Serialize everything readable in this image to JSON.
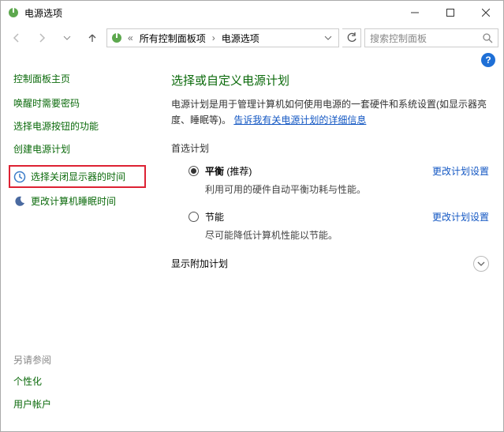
{
  "window": {
    "title": "电源选项"
  },
  "breadcrumb": {
    "item1": "所有控制面板项",
    "item2": "电源选项"
  },
  "search": {
    "placeholder": "搜索控制面板"
  },
  "sidebar": {
    "home": "控制面板主页",
    "links": {
      "l0": "唤醒时需要密码",
      "l1": "选择电源按钮的功能",
      "l2": "创建电源计划",
      "l3": "选择关闭显示器的时间",
      "l4": "更改计算机睡眠时间"
    },
    "seealso": "另请参阅",
    "seealso_items": {
      "s0": "个性化",
      "s1": "用户帐户"
    }
  },
  "main": {
    "heading": "选择或自定义电源计划",
    "desc_prefix": "电源计划是用于管理计算机如何使用电源的一套硬件和系统设置(如显示器亮度、睡眠等)。",
    "desc_link": "告诉我有关电源计划的详细信息",
    "preferred": "首选计划",
    "plan1": {
      "name_prefix": "平衡",
      "name_suffix": " (推荐)",
      "desc": "利用可用的硬件自动平衡功耗与性能。",
      "change": "更改计划设置"
    },
    "plan2": {
      "name": "节能",
      "desc": "尽可能降低计算机性能以节能。",
      "change": "更改计划设置"
    },
    "showmore": "显示附加计划"
  }
}
